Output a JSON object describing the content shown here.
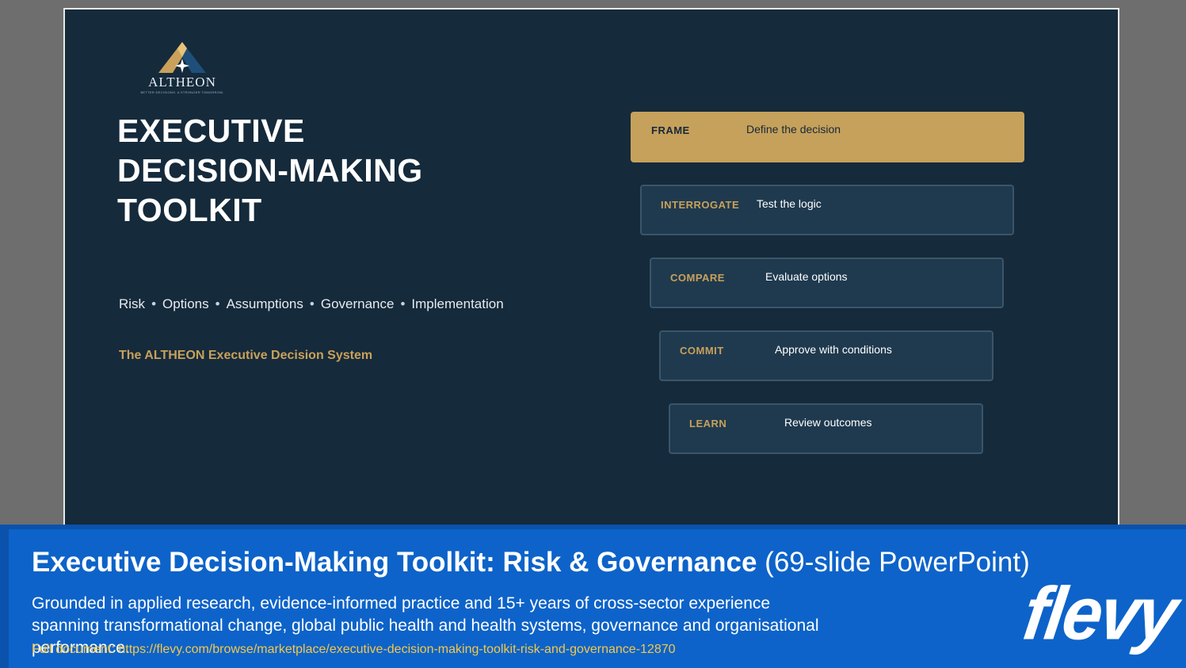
{
  "slide": {
    "logo": {
      "name": "ALTHEON",
      "tagline": "BETTER DECISIONS. A STRONGER TOMORROW."
    },
    "title_lines": [
      "EXECUTIVE",
      "DECISION-MAKING",
      "TOOLKIT"
    ],
    "topics": [
      "Risk",
      "Options",
      "Assumptions",
      "Governance",
      "Implementation"
    ],
    "topic_separator": "•",
    "system_name": "The ALTHEON Executive Decision System",
    "steps": [
      {
        "label": "FRAME",
        "desc": "Define the decision"
      },
      {
        "label": "INTERROGATE",
        "desc": "Test the logic"
      },
      {
        "label": "COMPARE",
        "desc": "Evaluate options"
      },
      {
        "label": "COMMIT",
        "desc": "Approve with conditions"
      },
      {
        "label": "LEARN",
        "desc": "Review outcomes"
      }
    ],
    "colors": {
      "background": "#152a3b",
      "gold": "#c6a15b",
      "card": "#1f3a4f"
    }
  },
  "banner": {
    "title_bold": "Executive Decision-Making Toolkit: Risk & Governance",
    "title_light": "(69-slide PowerPoint)",
    "description": "Grounded in applied research, evidence-informed practice and 15+ years of cross-sector experience spanning transformational change, global public health and health systems, governance and organisational performance.",
    "link": "Full document: https://flevy.com/browse/marketplace/executive-decision-making-toolkit-risk-and-governance-12870",
    "brand": "flevy"
  }
}
